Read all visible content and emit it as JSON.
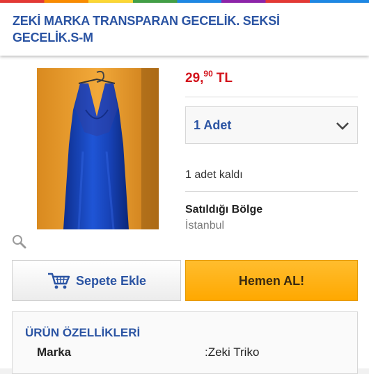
{
  "header": {
    "title": "ZEKİ MARKA TRANSPARAN GECELİK. SEKSİ GECELİK.S-M"
  },
  "product": {
    "price_main": "29,",
    "price_cents": "90",
    "currency": "TL",
    "quantity_selected": "1 Adet",
    "stock_text": "1 adet kaldı",
    "region_title": "Satıldığı Bölge",
    "region_value": "İstanbul"
  },
  "actions": {
    "add_to_cart": "Sepete Ekle",
    "buy_now": "Hemen AL!"
  },
  "features": {
    "title": "ÜRÜN ÖZELLİKLERİ",
    "rows": [
      {
        "key": "Marka",
        "value": ":Zeki Triko"
      }
    ]
  },
  "icons": {
    "zoom": "magnifier-icon",
    "cart": "shopping-cart-icon",
    "dropdown": "chevron-down-icon"
  },
  "colors": {
    "accent": "#2b54a3",
    "price": "#d3141c",
    "buy_button": "#ffad14"
  }
}
